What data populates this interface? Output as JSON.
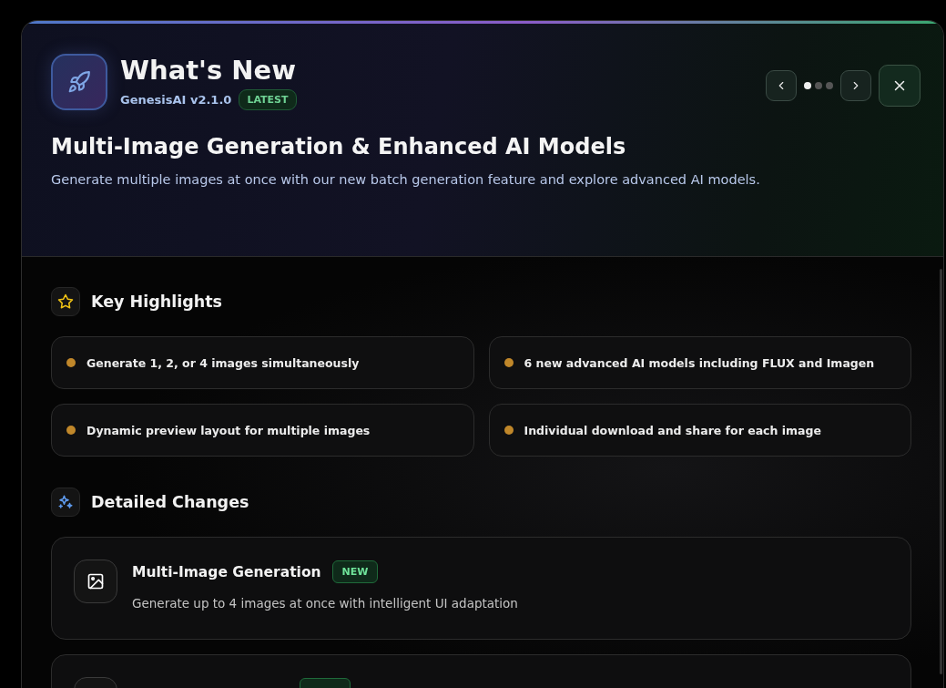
{
  "header": {
    "title": "What's New",
    "version": "GenesisAI v2.1.0",
    "version_badge": "LATEST",
    "headline": "Multi-Image Generation & Enhanced AI Models",
    "description": "Generate multiple images at once with our new batch generation feature and explore advanced AI models.",
    "pager": [
      {
        "selected": true
      },
      {
        "selected": false
      },
      {
        "selected": false
      }
    ]
  },
  "highlights": {
    "title": "Key Highlights",
    "items": [
      {
        "text": "Generate 1, 2, or 4 images simultaneously",
        "color": "#c0872a"
      },
      {
        "text": "6 new advanced AI models including FLUX and Imagen",
        "color": "#c0872a"
      },
      {
        "text": "Dynamic preview layout for multiple images",
        "color": "#c0872a"
      },
      {
        "text": "Individual download and share for each image",
        "color": "#c0872a"
      }
    ]
  },
  "changes": {
    "title": "Detailed Changes",
    "items": [
      {
        "title": "Multi-Image Generation",
        "badge": "NEW",
        "description": "Generate up to 4 images at once with intelligent UI adaptation"
      },
      {
        "badge_cut": true
      }
    ]
  }
}
